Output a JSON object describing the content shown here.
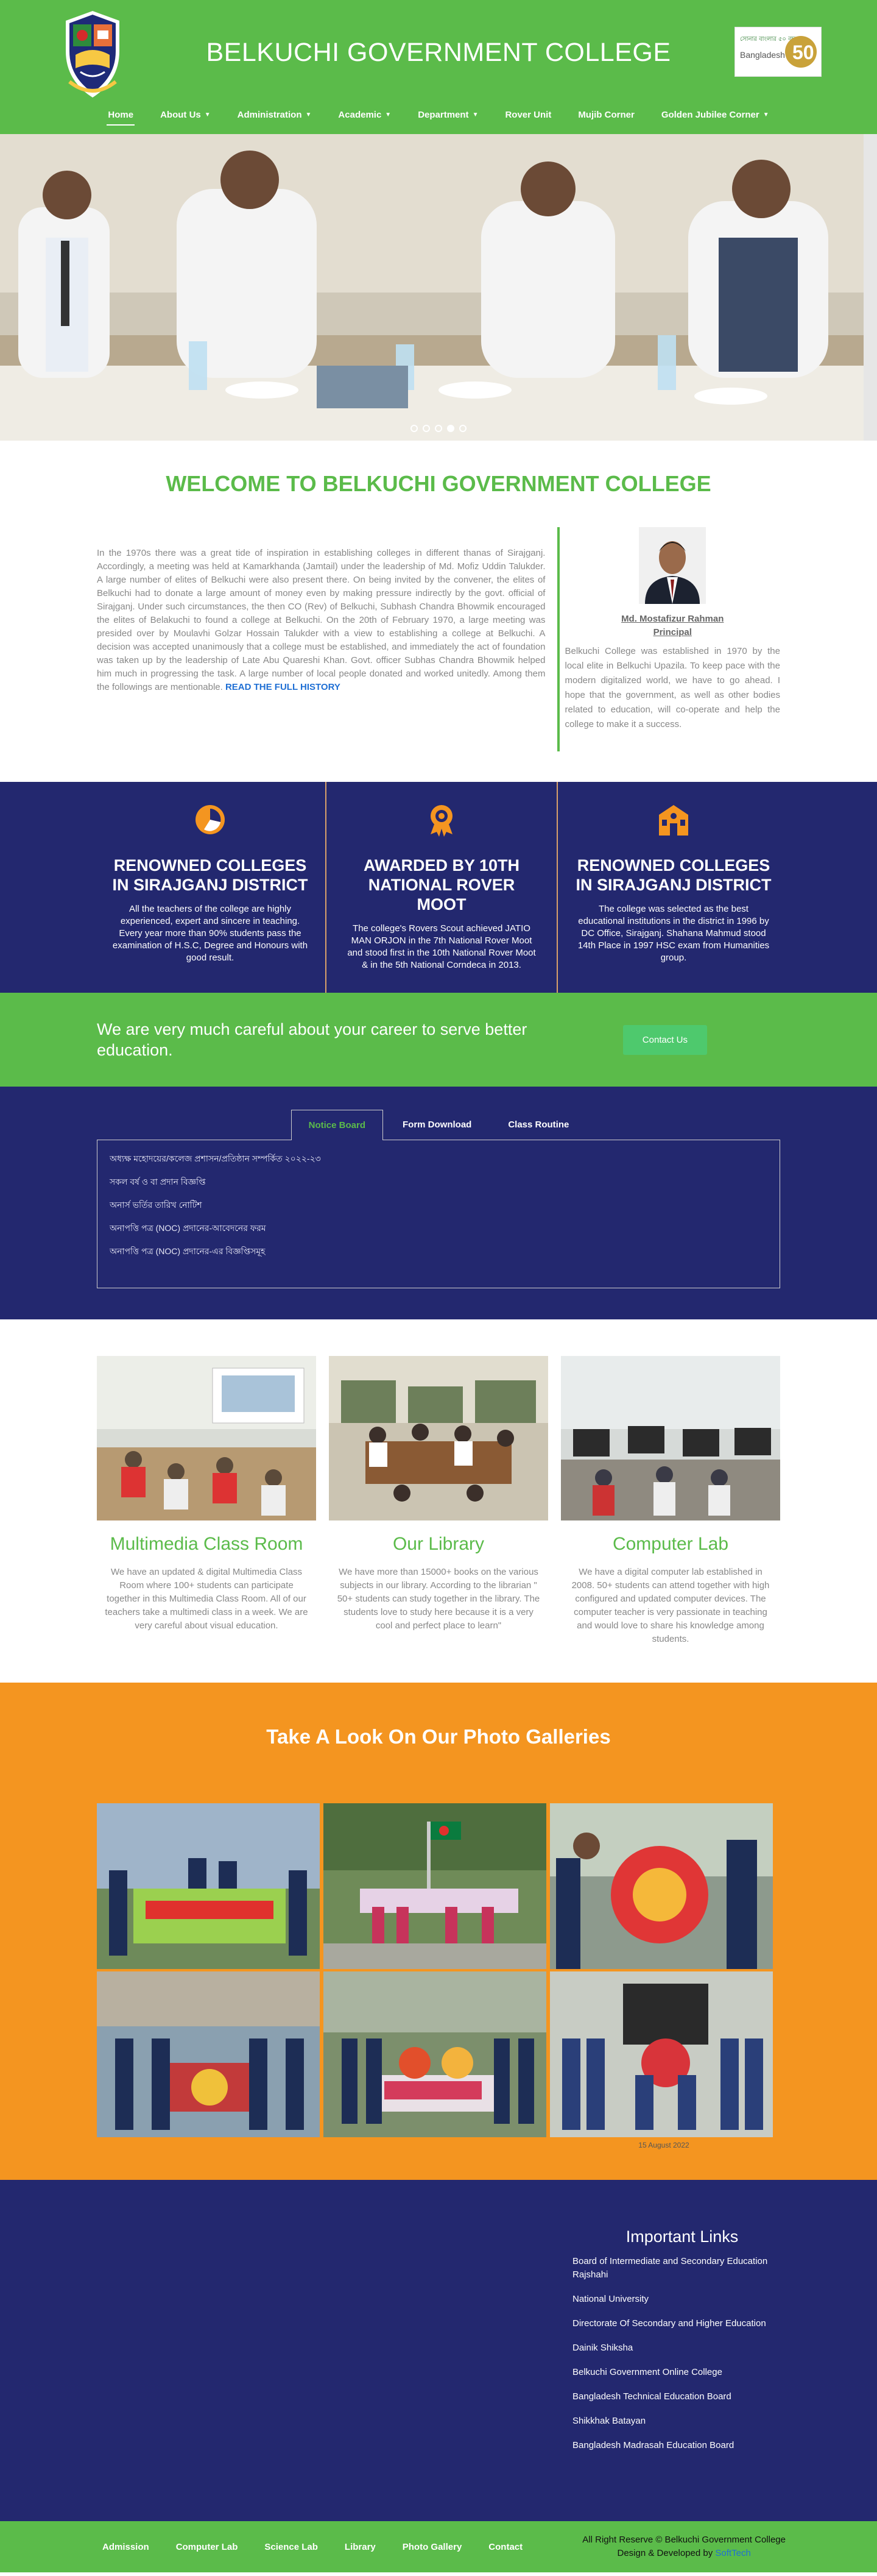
{
  "header": {
    "title": "BELKUCHI GOVERNMENT COLLEGE",
    "jubilee_text_top": "সোনার বাংলার ৫০ বছর",
    "jubilee_text": "Bangladesh",
    "jubilee_num": "50"
  },
  "nav": {
    "items": [
      {
        "label": "Home",
        "dropdown": false
      },
      {
        "label": "About Us",
        "dropdown": true
      },
      {
        "label": "Administration",
        "dropdown": true
      },
      {
        "label": "Academic",
        "dropdown": true
      },
      {
        "label": "Department",
        "dropdown": true
      },
      {
        "label": "Rover Unit",
        "dropdown": false
      },
      {
        "label": "Mujib Corner",
        "dropdown": false
      },
      {
        "label": "Golden Jubilee Corner",
        "dropdown": true
      }
    ]
  },
  "welcome": {
    "heading": "WELCOME TO BELKUCHI GOVERNMENT COLLEGE",
    "history": "In the 1970s there was a great tide of inspiration in establishing colleges in different thanas of Sirajganj. Accordingly, a meeting was held at Kamarkhanda (Jamtail) under the leadership of Md. Mofiz Uddin Talukder. A large number of elites of Belkuchi were also present there. On being invited by the convener, the elites of Belkuchi had to donate a large amount of money even by making pressure indirectly by the govt. official of Sirajganj. Under such circumstances, the then CO (Rev) of Belkuchi, Subhash Chandra Bhowmik encouraged the elites of Belakuchi to found a college at Belkuchi. On the 20th of February 1970, a large meeting was presided over by Moulavhi Golzar Hossain Talukder with a view to establishing a college at Belkuchi. A decision was accepted unanimously that a college must be established, and immediately the act of foundation was taken up by the leadership of Late Abu Quareshi Khan. Govt. officer Subhas Chandra Bhowmik helped him much in progressing the task. A large number of local people donated and worked unitedly. Among them the followings are mentionable.",
    "read_more": "READ THE FULL HISTORY",
    "principal_name": "Md. Mostafizur Rahman",
    "principal_title": "Principal",
    "principal_message": "Belkuchi College was established in 1970 by the local elite in Belkuchi Upazila. To keep pace with the modern digitalized world, we have to go ahead. I hope that the government, as well as other bodies related to education, will co-operate and help the college to make it a success."
  },
  "features": [
    {
      "icon": "pie-chart-icon",
      "title": "RENOWNED COLLEGES IN SIRAJGANJ DISTRICT",
      "text": "All the teachers of the college are highly experienced, expert and sincere in teaching. Every year more than 90% students pass the examination of H.S.C, Degree and Honours with good result."
    },
    {
      "icon": "award-medal-icon",
      "title": "AWARDED BY 10TH NATIONAL ROVER MOOT",
      "text": "The college's Rovers Scout achieved JATIO MAN ORJON in the 7th National Rover Moot and stood first in the 10th National Rover Moot & in the 5th National Corndeca in 2013."
    },
    {
      "icon": "school-building-icon",
      "title": "RENOWNED COLLEGES IN SIRAJGANJ DISTRICT",
      "text": "The college was selected as the best educational institutions in the district in 1996 by DC Office, Sirajganj. Shahana Mahmud stood 14th Place in 1997 HSC exam from Humanities group."
    }
  ],
  "cta": {
    "text": "We are very much careful about your career to serve better education.",
    "button": "Contact Us"
  },
  "board": {
    "tabs": [
      "Notice Board",
      "Form Download",
      "Class Routine"
    ],
    "notices": [
      "অধ্যক্ষ মহোদয়ের/কলেজ প্রশাসন/প্রতিষ্ঠান সম্পর্কিত ২০২২-২৩",
      "সকল বর্ষ ও বা প্রদান বিজ্ঞপ্তি",
      "অনার্স ভর্তির তারিখ নোটিশ",
      "অনাপত্তি পত্র (NOC) প্রদানের-আবেদনের ফরম",
      "অনাপত্তি পত্র (NOC) প্রদানের-এর বিজ্ঞপ্তিসমূহ"
    ]
  },
  "facilities": [
    {
      "title": "Multimedia Class Room",
      "text": "We have an updated & digital Multimedia Class Room where 100+ students can participate together in this Multimedia Class Room. All of our teachers take a multimedi class in a week. We are very careful about visual education."
    },
    {
      "title": "Our Library",
      "text": "We have more than 15000+ books on the various subjects in our library. According to the librarian \" 50+ students can study together in the library. The students love to study here because it is a very cool and perfect place to learn\""
    },
    {
      "title": "Computer Lab",
      "text": "We have a digital computer lab established in 2008. 50+ students can attend together with high configured and updated computer devices. The computer teacher is very passionate in teaching and would love to share his knowledge among students."
    }
  ],
  "gallery": {
    "heading": "Take A Look On Our Photo Galleries",
    "date": "15 August 2022"
  },
  "important_links": {
    "heading": "Important Links",
    "links": [
      "Board of Intermediate and Secondary Education Rajshahi",
      "National University",
      "Directorate Of Secondary and Higher Education",
      "Dainik Shiksha",
      "Belkuchi Government Online College",
      "Bangladesh Technical Education Board",
      "Shikkhak Batayan",
      "Bangladesh Madrasah Education Board"
    ]
  },
  "footer": {
    "links": [
      "Admission",
      "Computer Lab",
      "Science Lab",
      "Library",
      "Photo Gallery",
      "Contact"
    ],
    "copyright": "All Right Reserve © Belkuchi Government College",
    "developed_prefix": "Design & Developed by ",
    "developer": "SoftTech"
  },
  "colors": {
    "green": "#5bbb4a",
    "navy": "#23286f",
    "orange": "#f49520"
  }
}
